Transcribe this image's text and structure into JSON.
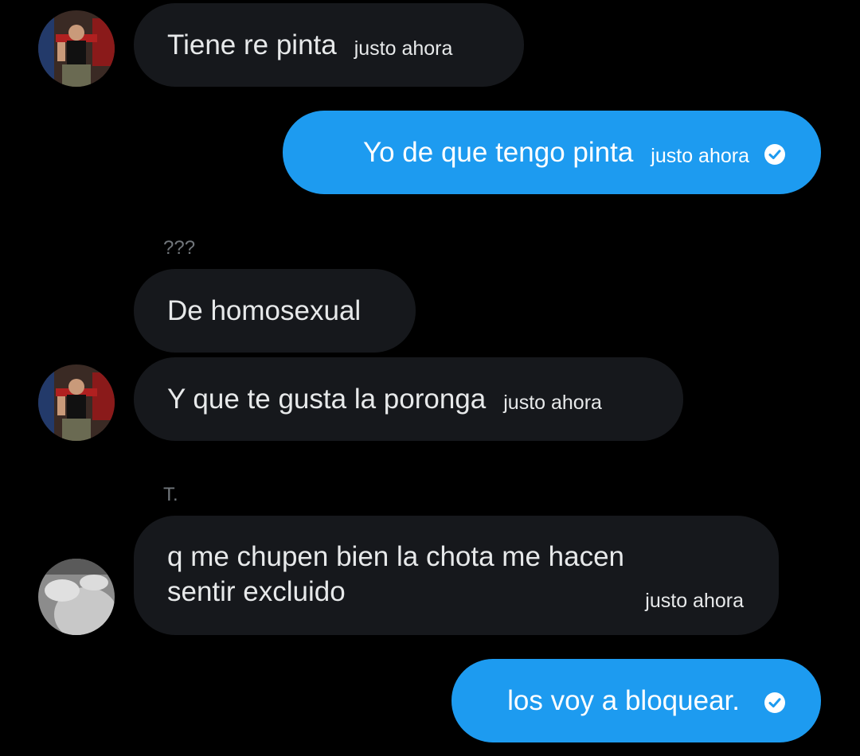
{
  "messages": [
    {
      "text": "Tiene re pinta",
      "time": "justo ahora"
    },
    {
      "text": "Yo de que tengo pinta",
      "time": "justo ahora"
    },
    {
      "text": "De homosexual"
    },
    {
      "text": "Y que te gusta la poronga",
      "time": "justo ahora"
    },
    {
      "text_line1": "q me chupen bien la chota me hacen",
      "text_line2": "sentir excluido",
      "time": "justo ahora"
    },
    {
      "text": "los voy a bloquear."
    }
  ],
  "sender_labels": {
    "first": "???",
    "second": "T."
  },
  "colors": {
    "background": "#000000",
    "incoming_bubble": "#16181c",
    "outgoing_bubble": "#1d9bf0",
    "sender_label": "#71767b"
  },
  "icons": {
    "read_receipt": "check-circle-icon",
    "avatar": "avatar"
  }
}
